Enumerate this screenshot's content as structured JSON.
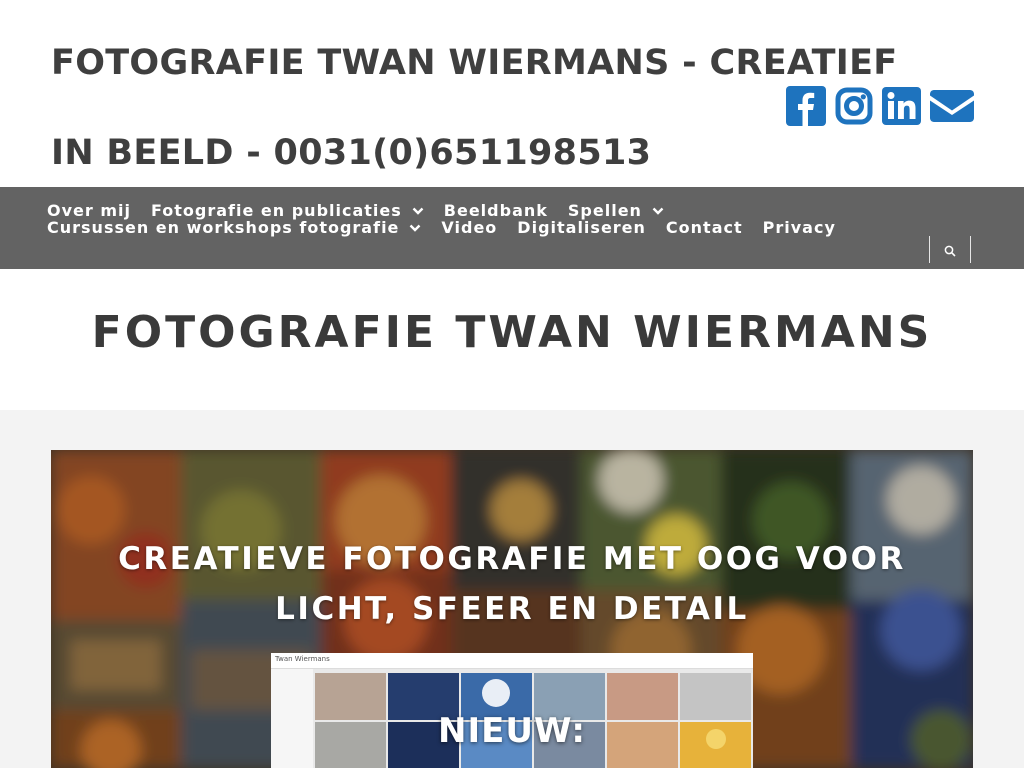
{
  "header": {
    "site_title": "FOTOGRAFIE TWAN WIERMANS - CREATIEF IN BEELD - 0031(0)651198513",
    "social": [
      {
        "icon": "facebook-icon"
      },
      {
        "icon": "instagram-icon"
      },
      {
        "icon": "linkedin-icon"
      },
      {
        "icon": "email-icon"
      }
    ],
    "social_color": "#1e73be"
  },
  "nav": {
    "items": [
      {
        "label": "Over mij",
        "has_submenu": false
      },
      {
        "label": "Fotografie en publicaties",
        "has_submenu": true
      },
      {
        "label": "Beeldbank",
        "has_submenu": false
      },
      {
        "label": "Spellen",
        "has_submenu": true
      },
      {
        "label": "Cursussen en workshops fotografie",
        "has_submenu": true
      },
      {
        "label": "Video",
        "has_submenu": false
      },
      {
        "label": "Digitaliseren",
        "has_submenu": false
      },
      {
        "label": "Contact",
        "has_submenu": false
      },
      {
        "label": "Privacy",
        "has_submenu": false
      }
    ],
    "search_icon": "search-icon",
    "background": "#636363"
  },
  "page": {
    "title": "FOTOGRAFIE TWAN WIERMANS"
  },
  "hero": {
    "heading": "CREATIEVE FOTOGRAFIE MET OOG VOOR LICHT, SFEER EN DETAIL",
    "preview_site_name": "Twan Wiermans",
    "badge": "NIEUW:"
  }
}
